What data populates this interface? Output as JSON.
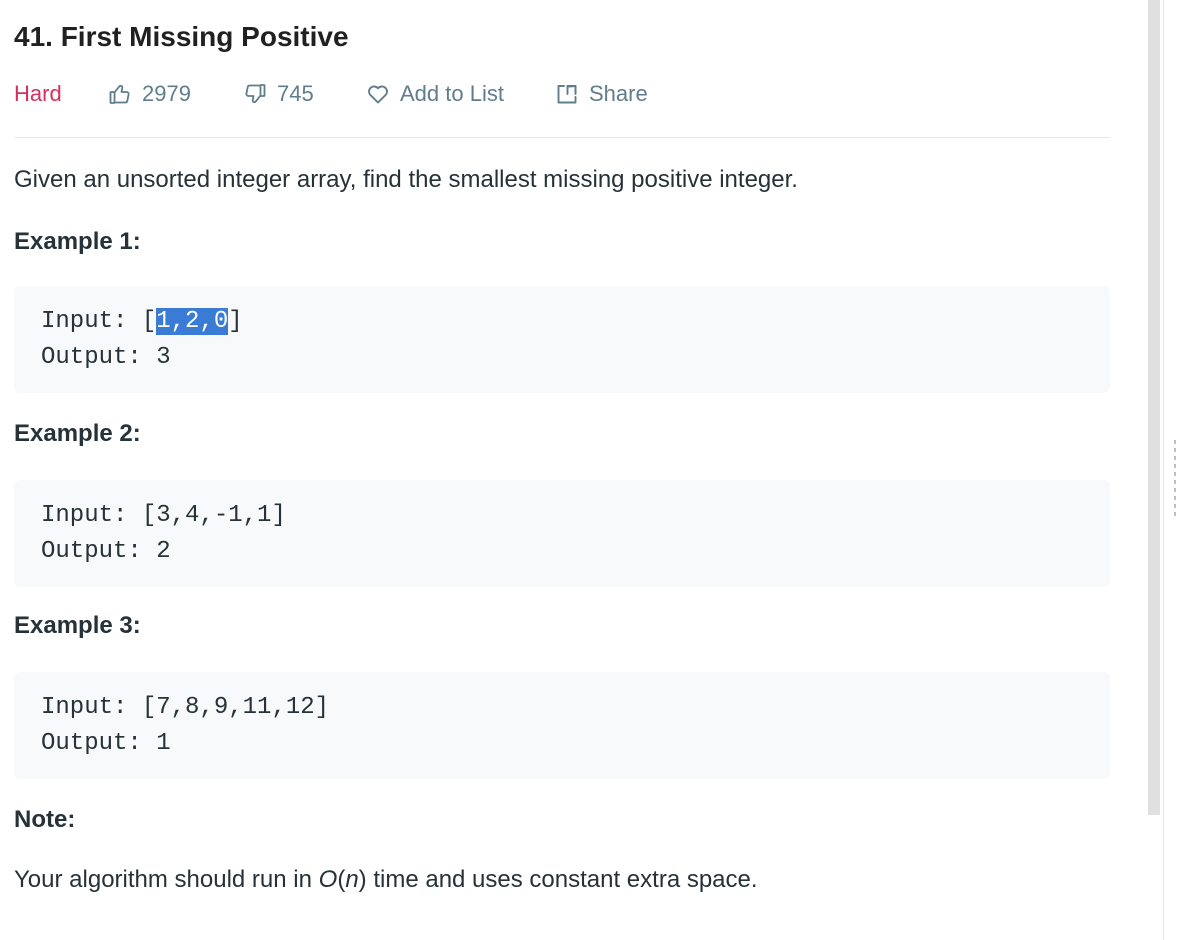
{
  "problem": {
    "title": "41. First Missing Positive",
    "difficulty": "Hard",
    "likes": "2979",
    "dislikes": "745",
    "add_to_list_label": "Add to List",
    "share_label": "Share",
    "description": "Given an unsorted integer array, find the smallest missing positive integer."
  },
  "examples": [
    {
      "heading": "Example 1:",
      "input_prefix": "Input: [",
      "input_selected": "1,2,0",
      "input_suffix": "]",
      "output": "Output: 3"
    },
    {
      "heading": "Example 2:",
      "input": "Input: [3,4,-1,1]",
      "output": "Output: 2"
    },
    {
      "heading": "Example 3:",
      "input": "Input: [7,8,9,11,12]",
      "output": "Output: 1"
    }
  ],
  "note": {
    "heading": "Note:",
    "text_before": "Your algorithm should run in ",
    "o": "O",
    "paren_open": "(",
    "n": "n",
    "text_after": ") time and uses constant extra space."
  },
  "icons": {
    "likes": "thumbs-up-icon",
    "dislikes": "thumbs-down-icon",
    "add_to_list": "heart-icon",
    "share": "share-icon"
  },
  "colors": {
    "difficulty_hard": "#d52f5e",
    "meta_text": "#607d8b",
    "selection": "#3a7bd5",
    "code_bg": "#f7f9fa"
  }
}
